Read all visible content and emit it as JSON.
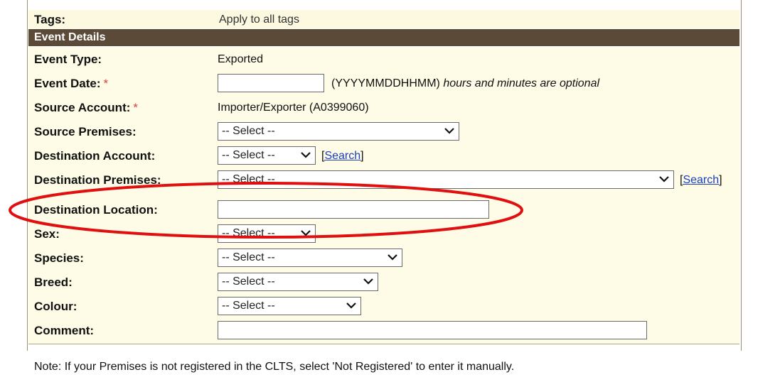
{
  "tags": {
    "label": "Tags:",
    "value": "Apply to all tags"
  },
  "section": {
    "title": "Event Details"
  },
  "fields": {
    "event_type": {
      "label": "Event Type:",
      "value": "Exported"
    },
    "event_date": {
      "label": "Event Date:",
      "required_mark": "*",
      "value": "",
      "format_hint": "(YYYYMMDDHHMM)",
      "optional_hint": "hours and minutes are optional"
    },
    "source_account": {
      "label": "Source Account:",
      "required_mark": "*",
      "value": "Importer/Exporter (A0399060)"
    },
    "source_premises": {
      "label": "Source Premises:",
      "selected": "-- Select --"
    },
    "destination_account": {
      "label": "Destination Account:",
      "selected": "-- Select --",
      "search_label": "Search"
    },
    "destination_premises": {
      "label": "Destination Premises:",
      "selected": "-- Select --",
      "search_label": "Search"
    },
    "destination_location": {
      "label": "Destination Location:",
      "value": ""
    },
    "sex": {
      "label": "Sex:",
      "selected": "-- Select --"
    },
    "species": {
      "label": "Species:",
      "selected": "-- Select --"
    },
    "breed": {
      "label": "Breed:",
      "selected": "-- Select --"
    },
    "colour": {
      "label": "Colour:",
      "selected": "-- Select --"
    },
    "comment": {
      "label": "Comment:",
      "value": ""
    }
  },
  "note": "Note: If your Premises is not registered in the CLTS, select 'Not Registered' to enter it manually.",
  "colors": {
    "header_bg": "#5c4a38",
    "form_bg": "#fefbe6",
    "required": "#e23b3b",
    "link": "#1a3fbf",
    "annotation": "#e01010"
  },
  "icons": {
    "dropdown": "chevron-down-icon"
  }
}
